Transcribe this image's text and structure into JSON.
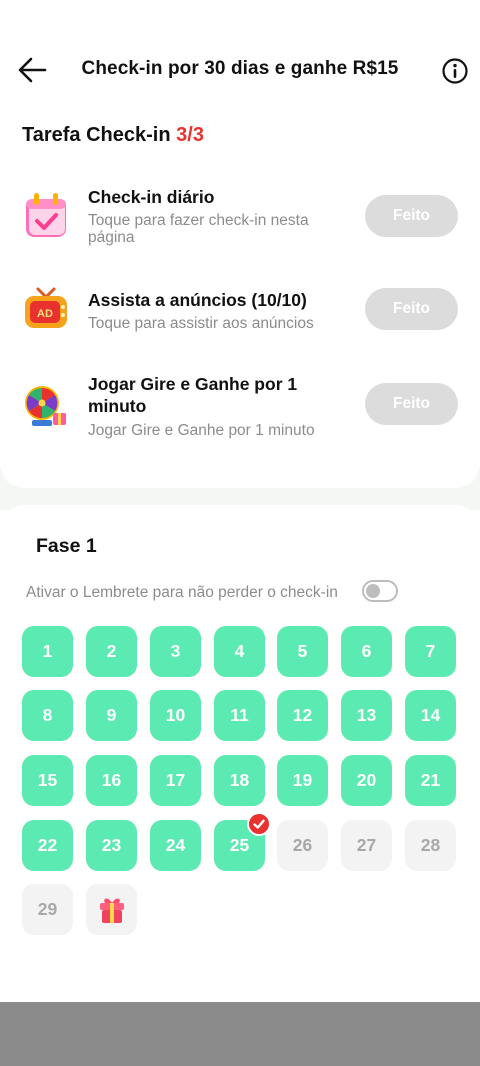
{
  "header": {
    "title": "Check-in por 30 dias e ganhe R$15",
    "back_icon": "arrow-left-icon",
    "info_icon": "info-circle-icon"
  },
  "tasks": {
    "title": "Tarefa Check-in",
    "count": "3/3",
    "items": [
      {
        "name": "Check-in diário",
        "subtitle": "Toque para fazer check-in nesta página",
        "button": "Feito",
        "icon": "calendar-check-icon"
      },
      {
        "name": "Assista a anúncios  (10/10)",
        "subtitle": "Toque para assistir aos anúncios",
        "button": "Feito",
        "icon": "ad-tv-icon"
      },
      {
        "name": "Jogar Gire e Ganhe por 1 minuto",
        "subtitle": "Jogar Gire e Ganhe por 1 minuto",
        "button": "Feito",
        "icon": "prize-wheel-icon"
      }
    ]
  },
  "phase": {
    "title": "Fase 1",
    "reminder_label": "Ativar o Lembrete para não perder o check-in",
    "reminder_enabled": false,
    "days": [
      "1",
      "2",
      "3",
      "4",
      "5",
      "6",
      "7",
      "8",
      "9",
      "10",
      "11",
      "12",
      "13",
      "14",
      "15",
      "16",
      "17",
      "18",
      "19",
      "20",
      "21",
      "22",
      "23",
      "24",
      "25",
      "26",
      "27",
      "28",
      "29"
    ],
    "completed_days": 25,
    "today": "25",
    "reward_icon": "gift-box-icon"
  },
  "colors": {
    "accent_green": "#5beab2",
    "count_red": "#e8322f",
    "done_button": "#dcdcdc"
  }
}
